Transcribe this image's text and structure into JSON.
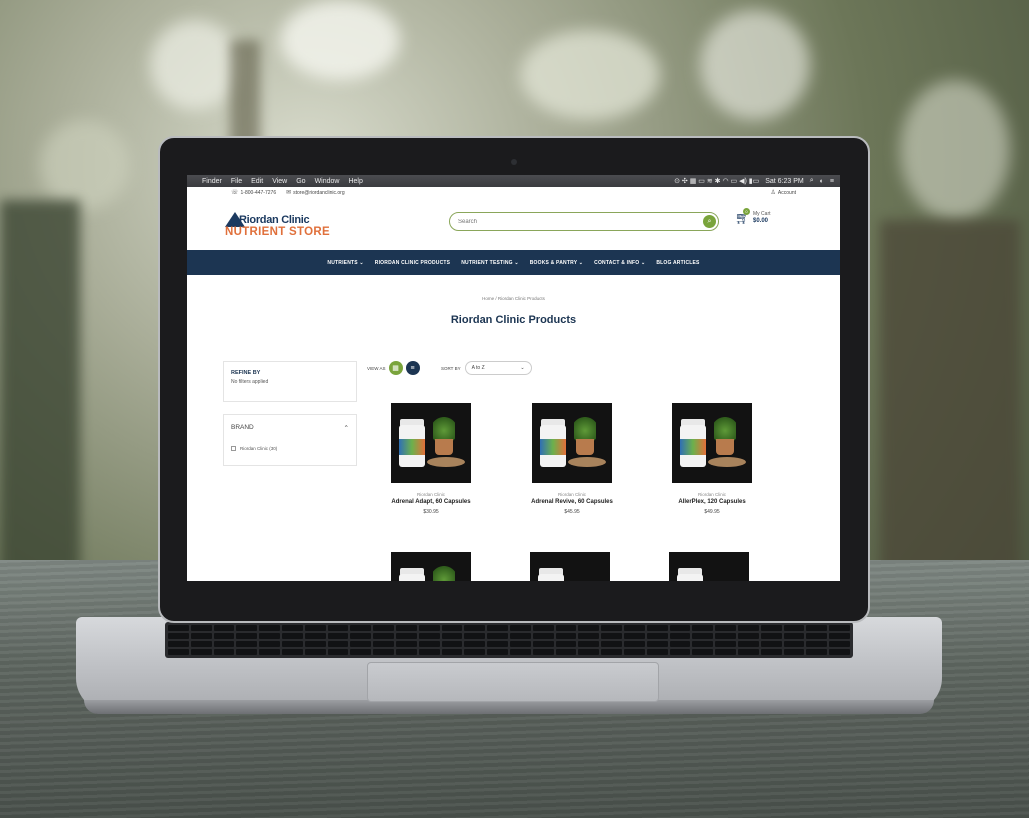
{
  "menubar": {
    "apple": "",
    "items": [
      "Finder",
      "File",
      "Edit",
      "View",
      "Go",
      "Window",
      "Help"
    ],
    "clock": "Sat 6:23 PM"
  },
  "topbar": {
    "phone": "1-800-447-7276",
    "email": "store@riordanclinic.org",
    "account": "Account"
  },
  "logo": {
    "line1": "Riordan Clinic",
    "line2": "NUTRIENT STORE"
  },
  "search": {
    "placeholder": "Search"
  },
  "cart": {
    "count": "0",
    "label": "My Cart",
    "total": "$0.00"
  },
  "nav": [
    "NUTRIENTS ⌄",
    "RIORDAN CLINIC PRODUCTS",
    "NUTRIENT TESTING ⌄",
    "BOOKS & PANTRY ⌄",
    "CONTACT & INFO ⌄",
    "BLOG ARTICLES"
  ],
  "breadcrumb": "Home / Riordan Clinic Products",
  "page_title": "Riordan Clinic Products",
  "sidebar": {
    "refine_title": "REFINE BY",
    "refine_text": "No filters applied",
    "brand_title": "BRAND",
    "brand_option": "Riordan Clinic (30)"
  },
  "toolbar": {
    "view_as": "VIEW AS",
    "sort_by": "SORT BY",
    "sort_value": "A to Z"
  },
  "products": [
    {
      "brand": "Riordan Clinic",
      "name": "Adrenal Adapt, 60 Capsules",
      "price": "$30.95"
    },
    {
      "brand": "Riordan Clinic",
      "name": "Adrenal Revive, 60 Capsules",
      "price": "$45.95"
    },
    {
      "brand": "Riordan Clinic",
      "name": "AllerPlex, 120 Capsules",
      "price": "$49.95"
    }
  ],
  "colors": {
    "navy": "#1c3552",
    "green": "#7aa43c",
    "orange": "#e0703b"
  }
}
